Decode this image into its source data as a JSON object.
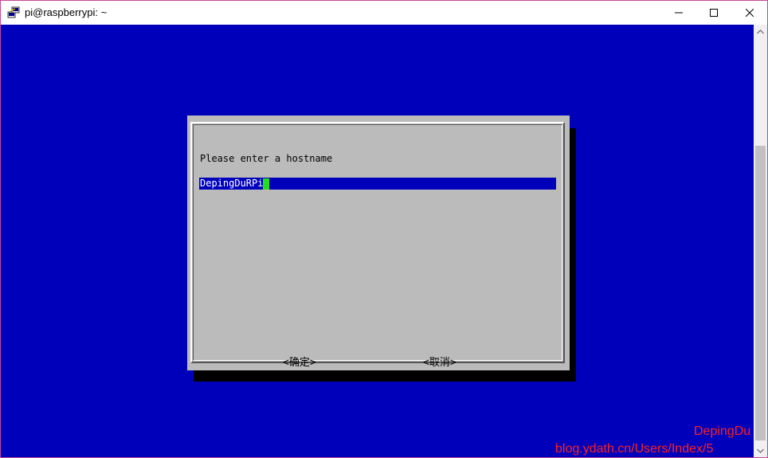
{
  "window": {
    "title": "pi@raspberrypi: ~"
  },
  "dialog": {
    "prompt": "Please enter a hostname",
    "input_value": "DepingDuRPi",
    "ok_label": "<确定>",
    "cancel_label": "<取消>"
  },
  "watermark": {
    "line1": "DepingDu",
    "line2": "blog.ydath.cn/Users/Index/5"
  },
  "colors": {
    "terminal_bg": "#0000bb",
    "dialog_bg": "#bbbbbb",
    "cursor": "#22dd22",
    "watermark": "#ff2222"
  }
}
